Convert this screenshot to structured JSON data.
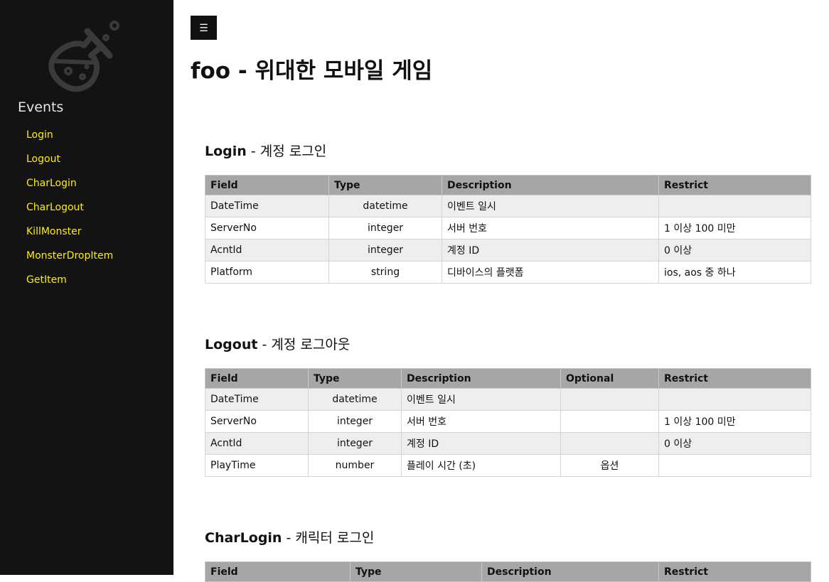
{
  "sidebar": {
    "heading": "Events",
    "items": [
      "Login",
      "Logout",
      "CharLogin",
      "CharLogout",
      "KillMonster",
      "MonsterDropItem",
      "GetItem"
    ]
  },
  "header": {
    "menu_icon": "hamburger-icon",
    "title": "foo - 위대한 모바일 게임"
  },
  "login": {
    "name": "Login",
    "desc": "계정 로그인",
    "headers": [
      "Field",
      "Type",
      "Description",
      "Restrict"
    ],
    "rows": [
      [
        "DateTime",
        "datetime",
        "이벤트 일시",
        ""
      ],
      [
        "ServerNo",
        "integer",
        "서버 번호",
        "1 이상 100 미만"
      ],
      [
        "AcntId",
        "integer",
        "계정 ID",
        "0 이상"
      ],
      [
        "Platform",
        "string",
        "디바이스의 플랫폼",
        "ios, aos 중 하나"
      ]
    ]
  },
  "logout": {
    "name": "Logout",
    "desc": "계정 로그아웃",
    "headers": [
      "Field",
      "Type",
      "Description",
      "Optional",
      "Restrict"
    ],
    "rows": [
      [
        "DateTime",
        "datetime",
        "이벤트 일시",
        "",
        ""
      ],
      [
        "ServerNo",
        "integer",
        "서버 번호",
        "",
        "1 이상 100 미만"
      ],
      [
        "AcntId",
        "integer",
        "계정 ID",
        "",
        "0 이상"
      ],
      [
        "PlayTime",
        "number",
        "플레이 시간 (초)",
        "옵션",
        ""
      ]
    ]
  },
  "charlogin": {
    "name": "CharLogin",
    "desc": "캐릭터 로그인",
    "headers": [
      "Field",
      "Type",
      "Description",
      "Restrict"
    ]
  },
  "colors": {
    "sidebar_bg": "#131313",
    "link": "#ffee00",
    "header_row": "#a6a6a6",
    "stripe": "#eeeeee"
  }
}
